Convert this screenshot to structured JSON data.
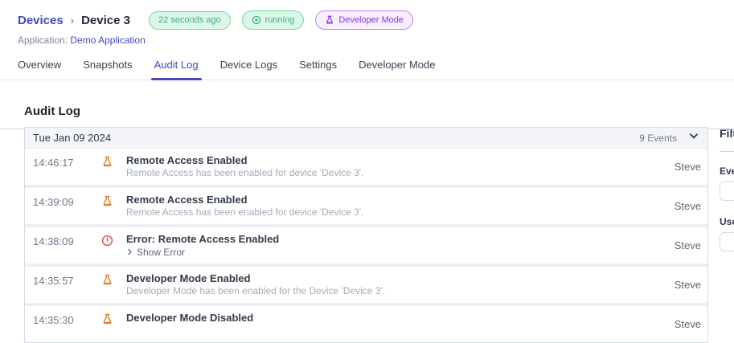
{
  "breadcrumb": {
    "parent": "Devices",
    "separator": "›",
    "current": "Device 3"
  },
  "badges": [
    {
      "label": "22 seconds ago",
      "style": "green",
      "icon": null
    },
    {
      "label": "running",
      "style": "green",
      "icon": "record-icon"
    },
    {
      "label": "Developer Mode",
      "style": "purple",
      "icon": "flask-icon"
    }
  ],
  "application": {
    "label": "Application:",
    "name": "Demo Application"
  },
  "tabs": [
    {
      "label": "Overview",
      "active": false
    },
    {
      "label": "Snapshots",
      "active": false
    },
    {
      "label": "Audit Log",
      "active": true
    },
    {
      "label": "Device Logs",
      "active": false
    },
    {
      "label": "Settings",
      "active": false
    },
    {
      "label": "Developer Mode",
      "active": false
    }
  ],
  "page": {
    "title": "Audit Log"
  },
  "audit_table": {
    "date_header": "Tue Jan 09 2024",
    "events_count": "9 Events",
    "rows": [
      {
        "time": "14:46:17",
        "icon": "flask",
        "title": "Remote Access Enabled",
        "description": "Remote Access has been enabled for device 'Device 3'.",
        "expandable": false,
        "user": "Steve"
      },
      {
        "time": "14:39:09",
        "icon": "flask",
        "title": "Remote Access Enabled",
        "description": "Remote Access has been enabled for device 'Device 3'.",
        "expandable": false,
        "user": "Steve"
      },
      {
        "time": "14:38:09",
        "icon": "error",
        "title": "Error: Remote Access Enabled",
        "description": "Show Error",
        "expandable": true,
        "user": "Steve"
      },
      {
        "time": "14:35:57",
        "icon": "flask",
        "title": "Developer Mode Enabled",
        "description": "Developer Mode has been enabled for the Device 'Device 3'.",
        "expandable": false,
        "user": "Steve"
      },
      {
        "time": "14:35:30",
        "icon": "flask",
        "title": "Developer Mode Disabled",
        "description": "",
        "expandable": false,
        "user": "Steve"
      }
    ]
  },
  "filter_panel": {
    "title": "Filter",
    "events_label": "Events",
    "user_label": "User"
  },
  "colors": {
    "accent_indigo": "#4348c2",
    "badge_green_text": "#3eb181",
    "badge_green_bg": "#d9f6e6",
    "badge_purple_text": "#8d33ea",
    "badge_purple_bg": "#f7eefe",
    "flask_orange": "#df8128",
    "error_red": "#e05252"
  }
}
